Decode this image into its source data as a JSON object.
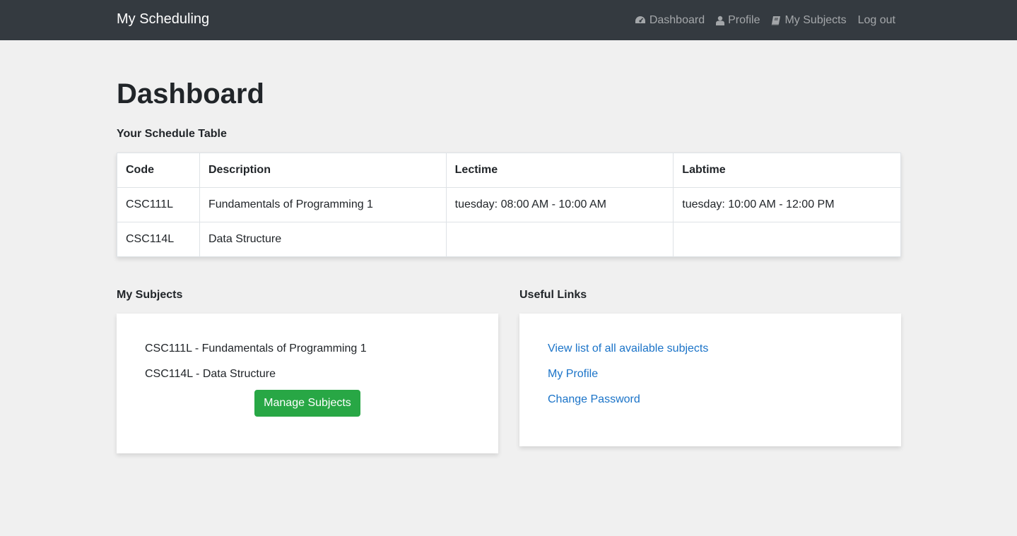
{
  "navbar": {
    "brand": "My Scheduling",
    "links": [
      {
        "label": "Dashboard",
        "icon": "tachometer-icon"
      },
      {
        "label": "Profile",
        "icon": "user-icon"
      },
      {
        "label": "My Subjects",
        "icon": "book-icon"
      },
      {
        "label": "Log out",
        "icon": ""
      }
    ]
  },
  "page": {
    "title": "Dashboard"
  },
  "schedule": {
    "heading": "Your Schedule Table",
    "columns": [
      "Code",
      "Description",
      "Lectime",
      "Labtime"
    ],
    "rows": [
      [
        "CSC111L",
        "Fundamentals of Programming 1",
        "tuesday: 08:00 AM - 10:00 AM",
        "tuesday: 10:00 AM - 12:00 PM"
      ],
      [
        "CSC114L",
        "Data Structure",
        "",
        ""
      ]
    ]
  },
  "subjects": {
    "heading": "My Subjects",
    "items": [
      "CSC111L - Fundamentals of Programming 1",
      "CSC114L - Data Structure"
    ],
    "button_label": "Manage Subjects"
  },
  "useful_links": {
    "heading": "Useful Links",
    "links": [
      "View list of all available subjects",
      "My Profile",
      "Change Password"
    ]
  },
  "colors": {
    "navbar_bg": "#343a40",
    "page_bg": "#f0f0f0",
    "link": "#1a73c8",
    "button": "#28a745"
  }
}
